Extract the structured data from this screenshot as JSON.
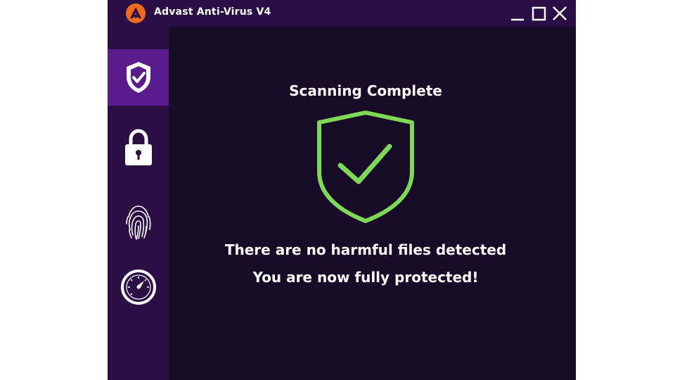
{
  "window": {
    "title": "Advast Anti-Virus V4",
    "controls": [
      "minimize",
      "maximize",
      "close"
    ]
  },
  "sidebar": {
    "items": [
      {
        "name": "protection",
        "icon": "shield-check-icon",
        "active": true
      },
      {
        "name": "privacy",
        "icon": "padlock-icon",
        "active": false
      },
      {
        "name": "identity",
        "icon": "fingerprint-icon",
        "active": false
      },
      {
        "name": "performance",
        "icon": "speedometer-icon",
        "active": false
      }
    ]
  },
  "main": {
    "status_title": "Scanning Complete",
    "status_icon": "shield-check-icon",
    "message_line1": "There are no harmful files detected",
    "message_line2": "You are now fully protected!"
  },
  "colors": {
    "titlebar": "#2b0e45",
    "sidebar": "#2a0e44",
    "sidebar_active": "#5a1c8c",
    "content_bg": "#170b28",
    "success_green": "#7ed957",
    "logo_orange": "#f26a1b"
  }
}
